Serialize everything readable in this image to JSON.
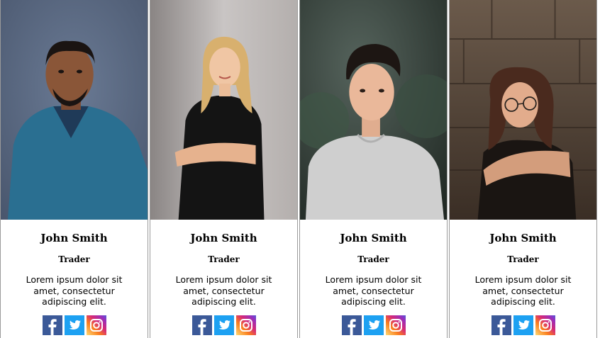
{
  "team": [
    {
      "name": "John Smith",
      "role": "Trader",
      "description": "Lorem ipsum dolor sit amet, consectetur adipiscing elit.",
      "photo": "man-blue-shirt-photo",
      "social": [
        "facebook-icon",
        "twitter-icon",
        "instagram-icon"
      ]
    },
    {
      "name": "John Smith",
      "role": "Trader",
      "description": "Lorem ipsum dolor sit amet, consectetur adipiscing elit.",
      "photo": "woman-black-top-photo",
      "social": [
        "facebook-icon",
        "twitter-icon",
        "instagram-icon"
      ]
    },
    {
      "name": "John Smith",
      "role": "Trader",
      "description": "Lorem ipsum dolor sit amet, consectetur adipiscing elit.",
      "photo": "young-man-grey-shirt-photo",
      "social": [
        "facebook-icon",
        "twitter-icon",
        "instagram-icon"
      ]
    },
    {
      "name": "John Smith",
      "role": "Trader",
      "description": "Lorem ipsum dolor sit amet, consectetur adipiscing elit.",
      "photo": "woman-glasses-photo",
      "social": [
        "facebook-icon",
        "twitter-icon",
        "instagram-icon"
      ]
    }
  ],
  "colors": {
    "facebook": "#3b5998",
    "twitter": "#1da1f2",
    "instagram_start": "#feda75",
    "instagram_mid": "#d62976",
    "instagram_end": "#4f5bd5",
    "card_border": "#9a9a9a"
  }
}
